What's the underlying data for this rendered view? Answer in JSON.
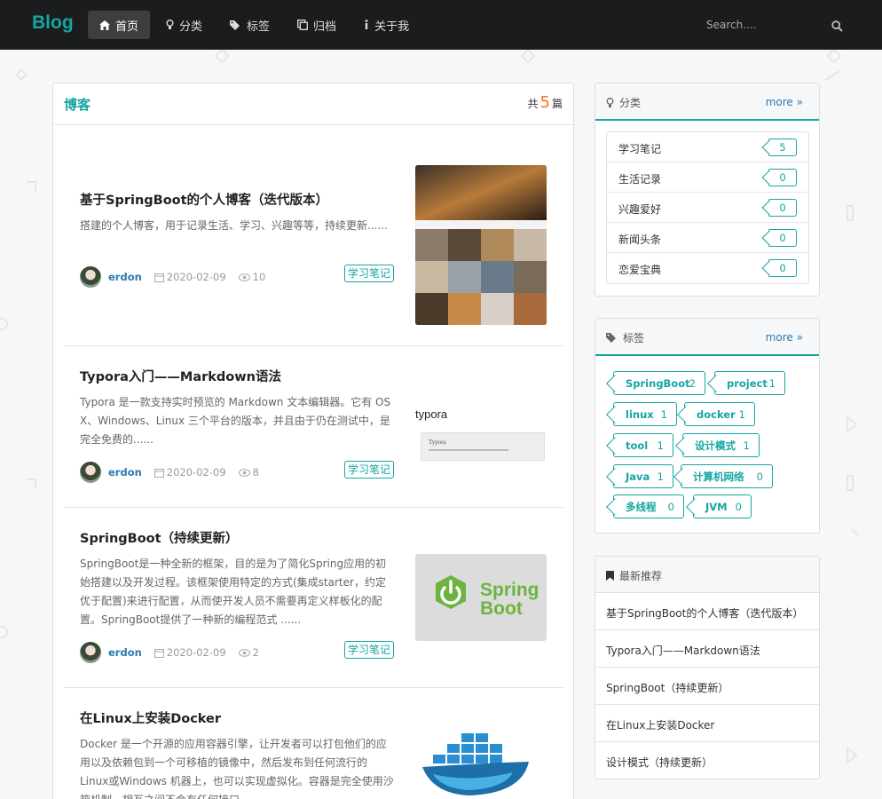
{
  "brand": "Blog",
  "nav": [
    {
      "label": "首页",
      "icon": "home-icon"
    },
    {
      "label": "分类",
      "icon": "lightbulb-icon"
    },
    {
      "label": "标签",
      "icon": "tags-icon"
    },
    {
      "label": "归档",
      "icon": "clone-icon"
    },
    {
      "label": "关于我",
      "icon": "info-icon"
    }
  ],
  "search": {
    "placeholder": "Search...."
  },
  "main": {
    "title": "博客",
    "count_prefix": "共",
    "count": "5",
    "count_suffix": "篇"
  },
  "posts": [
    {
      "title": "基于SpringBoot的个人博客（迭代版本）",
      "desc": "搭建的个人博客，用于记录生活、学习、兴趣等等，持续更新......",
      "author": "erdon",
      "date": "2020-02-09",
      "views": "10",
      "tag": "学习笔记"
    },
    {
      "title": "Typora入门——Markdown语法",
      "desc": "Typora 是一款支持实时预览的 Markdown 文本编辑器。它有 OS X、Windows、Linux 三个平台的版本，并且由于仍在测试中，是完全免费的......",
      "author": "erdon",
      "date": "2020-02-09",
      "views": "8",
      "tag": "学习笔记",
      "thumb_text": "typora",
      "thumb_sub": "Typora"
    },
    {
      "title": "SpringBoot（持续更新）",
      "desc": "SpringBoot是一种全新的框架，目的是为了简化Spring应用的初始搭建以及开发过程。该框架使用特定的方式(集成starter，约定优于配置)来进行配置，从而使开发人员不需要再定义样板化的配置。SpringBoot提供了一种新的编程范式 ......",
      "author": "erdon",
      "date": "2020-02-09",
      "views": "2",
      "tag": "学习笔记",
      "thumb_text1": "Spring",
      "thumb_text2": "Boot"
    },
    {
      "title": "在Linux上安装Docker",
      "desc": "Docker 是一个开源的应用容器引擎，让开发者可以打包他们的应用以及依赖包到一个可移植的镜像中，然后发布到任何流行的 Linux或Windows 机器上，也可以实现虚拟化。容器是完全使用沙箱机制，相互之间不会有任何接口。"
    }
  ],
  "categories": {
    "title": "分类",
    "more": "more",
    "items": [
      {
        "name": "学习笔记",
        "count": "5"
      },
      {
        "name": "生活记录",
        "count": "0"
      },
      {
        "name": "兴趣爱好",
        "count": "0"
      },
      {
        "name": "新闻头条",
        "count": "0"
      },
      {
        "name": "恋爱宝典",
        "count": "0"
      }
    ]
  },
  "tags": {
    "title": "标签",
    "more": "more",
    "items": [
      {
        "name": "SpringBoot",
        "count": "2"
      },
      {
        "name": "project",
        "count": "1"
      },
      {
        "name": "linux",
        "count": "1"
      },
      {
        "name": "docker",
        "count": "1"
      },
      {
        "name": "tool",
        "count": "1"
      },
      {
        "name": "设计模式",
        "count": "1"
      },
      {
        "name": "Java",
        "count": "1"
      },
      {
        "name": "计算机网络",
        "count": "0"
      },
      {
        "name": "多线程",
        "count": "0"
      },
      {
        "name": "JVM",
        "count": "0"
      }
    ]
  },
  "recommend": {
    "title": "最新推荐",
    "items": [
      "基于SpringBoot的个人博客（迭代版本）",
      "Typora入门——Markdown语法",
      "SpringBoot（持续更新）",
      "在Linux上安装Docker",
      "设计模式（持续更新）"
    ]
  },
  "colors": {
    "accent": "#16a5a3",
    "topbar": "#1b1c1d",
    "count": "#f2711c",
    "link": "#2a7ab0"
  }
}
